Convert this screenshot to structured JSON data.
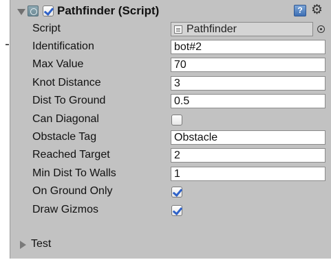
{
  "component": {
    "title": "Pathfinder (Script)",
    "enabled": true,
    "icons": {
      "script": "script-component-icon",
      "help": "help-icon",
      "help_glyph": "?",
      "gear": "gear-icon",
      "gear_glyph": "⚙"
    }
  },
  "properties": {
    "script": {
      "label": "Script",
      "value": "Pathfinder"
    },
    "identification": {
      "label": "Identification",
      "value": "bot#2"
    },
    "max_value": {
      "label": "Max Value",
      "value": "70"
    },
    "knot_distance": {
      "label": "Knot Distance",
      "value": "3"
    },
    "dist_to_ground": {
      "label": "Dist To Ground",
      "value": "0.5"
    },
    "can_diagonal": {
      "label": "Can Diagonal",
      "checked": false
    },
    "obstacle_tag": {
      "label": "Obstacle Tag",
      "value": "Obstacle"
    },
    "reached_target": {
      "label": "Reached Target",
      "value": "2"
    },
    "min_dist_to_walls": {
      "label": "Min Dist To Walls",
      "value": "1"
    },
    "on_ground_only": {
      "label": "On Ground Only",
      "checked": true
    },
    "draw_gizmos": {
      "label": "Draw Gizmos",
      "checked": true
    }
  },
  "test_foldout": {
    "label": "Test",
    "expanded": false
  }
}
